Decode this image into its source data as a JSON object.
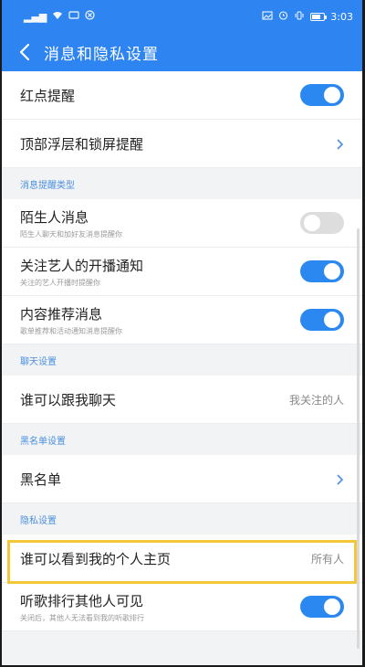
{
  "status_bar": {
    "left_icons": [
      "signal-icon",
      "wifi-icon",
      "message-icon",
      "nfc-icon"
    ],
    "right_icons": [
      "photo-icon",
      "alarm-icon",
      "vibrate-icon",
      "battery-icon"
    ],
    "time": "3:03"
  },
  "header": {
    "title": "消息和隐私设置",
    "back_icon": "chevron-left-icon",
    "bg_color": "#2e85f2"
  },
  "rows_top": [
    {
      "label": "红点提醒",
      "toggle": true
    },
    {
      "label": "顶部浮层和锁屏提醒",
      "chevron": true
    }
  ],
  "sections": {
    "message_types": {
      "title": "消息提醒类型",
      "items": [
        {
          "label": "陌生人消息",
          "sub": "陌生人聊天和加好友消息提醒你",
          "toggle": false
        },
        {
          "label": "关注艺人的开播通知",
          "sub": "关注的艺人开播时提醒你",
          "toggle": true
        },
        {
          "label": "内容推荐消息",
          "sub": "歌单推荐和活动通知消息提醒你",
          "toggle": true
        }
      ]
    },
    "chat": {
      "title": "聊天设置",
      "items": [
        {
          "label": "谁可以跟我聊天",
          "value": "我关注的人"
        }
      ]
    },
    "blacklist": {
      "title": "黑名单设置",
      "items": [
        {
          "label": "黑名单",
          "chevron": true
        }
      ]
    },
    "privacy": {
      "title": "隐私设置",
      "items": [
        {
          "label": "谁可以看到我的个人主页",
          "value": "所有人"
        },
        {
          "label": "听歌排行其他人可见",
          "sub": "关闭后，其他人无法看到我的听歌排行",
          "toggle": true
        }
      ]
    }
  },
  "colors": {
    "accent": "#2b88f0",
    "highlight": "#f2c83a",
    "section_text": "#4a8fe0"
  }
}
